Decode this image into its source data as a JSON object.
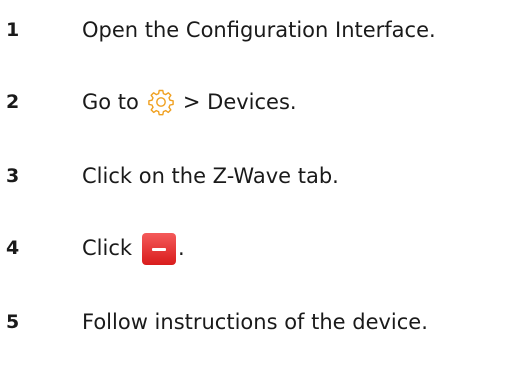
{
  "steps": [
    {
      "number": "1",
      "text": "Open the Configuration Interface."
    },
    {
      "number": "2",
      "before": "Go to",
      "icon": "gear-icon",
      "after": "> Devices."
    },
    {
      "number": "3",
      "text": "Click on the Z-Wave tab."
    },
    {
      "number": "4",
      "before": "Click",
      "icon": "remove-button-icon",
      "after": "."
    },
    {
      "number": "5",
      "text": "Follow instructions of the device."
    }
  ],
  "colors": {
    "text": "#1a1a1a",
    "gear_outline": "#f0a020",
    "remove_button": "#e02a2a"
  }
}
